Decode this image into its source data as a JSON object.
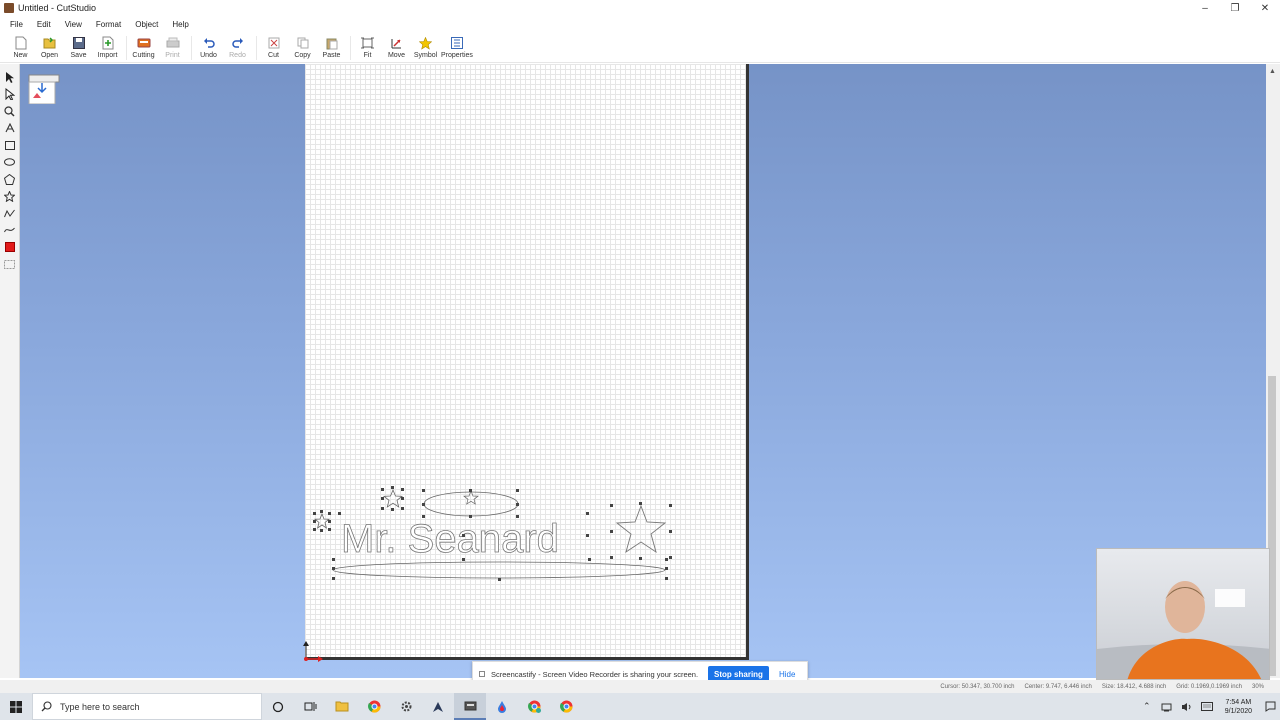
{
  "window": {
    "title": "Untitled - CutStudio",
    "minimize": "–",
    "maximize": "❐",
    "close": "✕"
  },
  "menu": [
    "File",
    "Edit",
    "View",
    "Format",
    "Object",
    "Help"
  ],
  "toolbar": [
    {
      "label": "New",
      "icon": "new-icon",
      "disabled": false
    },
    {
      "label": "Open",
      "icon": "open-icon",
      "disabled": false
    },
    {
      "label": "Save",
      "icon": "save-icon",
      "disabled": false
    },
    {
      "label": "Import",
      "icon": "import-icon",
      "disabled": false
    },
    {
      "label": "Cutting",
      "icon": "cutting-icon",
      "disabled": false
    },
    {
      "label": "Print",
      "icon": "print-icon",
      "disabled": true
    },
    {
      "label": "Undo",
      "icon": "undo-icon",
      "disabled": false
    },
    {
      "label": "Redo",
      "icon": "redo-icon",
      "disabled": true
    },
    {
      "label": "Cut",
      "icon": "cut-icon",
      "disabled": false
    },
    {
      "label": "Copy",
      "icon": "copy-icon",
      "disabled": false
    },
    {
      "label": "Paste",
      "icon": "paste-icon",
      "disabled": false
    },
    {
      "label": "Fit",
      "icon": "fit-icon",
      "disabled": false
    },
    {
      "label": "Move",
      "icon": "move-icon",
      "disabled": false
    },
    {
      "label": "Symbol",
      "icon": "symbol-icon",
      "disabled": false
    },
    {
      "label": "Properties",
      "icon": "properties-icon",
      "disabled": false
    }
  ],
  "canvas": {
    "design_text": "Mr. Seanard"
  },
  "share_bar": {
    "message": "Screencastify - Screen Video Recorder is sharing your screen.",
    "stop": "Stop sharing",
    "hide": "Hide"
  },
  "status": {
    "cursor": "Cursor: 50.347, 30.700 inch",
    "center": "Center: 9.747, 6.446 inch",
    "size": "Size: 18.412, 4.688 inch",
    "grid": "Grid: 0.1969,0.1969 inch",
    "zoom": "30%"
  },
  "taskbar": {
    "search_placeholder": "Type here to search",
    "time": "7:54 AM",
    "date": "9/1/2020"
  }
}
